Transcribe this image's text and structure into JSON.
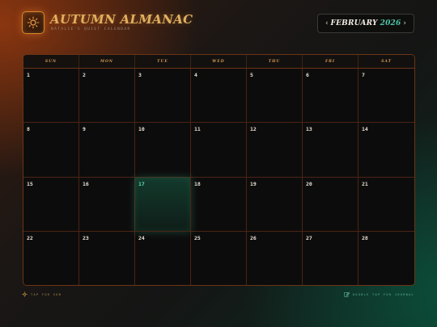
{
  "header": {
    "title": "AUTUMN ALMANAC",
    "subtitle": "NATALIE'S QUIET CALENDAR",
    "logo_icon": "sun-icon"
  },
  "month_nav": {
    "prev_icon": "chevron-left-icon",
    "prev_label": "‹",
    "month": "FEBRUARY",
    "year": "2026",
    "next_icon": "chevron-right-icon",
    "next_label": "›"
  },
  "calendar": {
    "weekdays": [
      "SUN",
      "MON",
      "TUE",
      "WED",
      "THU",
      "FRI",
      "SAT"
    ],
    "days": [
      "1",
      "2",
      "3",
      "4",
      "5",
      "6",
      "7",
      "8",
      "9",
      "10",
      "11",
      "12",
      "13",
      "14",
      "15",
      "16",
      "17",
      "18",
      "19",
      "20",
      "21",
      "22",
      "23",
      "24",
      "25",
      "26",
      "27",
      "28"
    ],
    "today": "17"
  },
  "footer": {
    "left_icon": "sun-icon",
    "left_hint": "TAP FOR SUN",
    "right_icon": "edit-icon",
    "right_hint": "DOUBLE TAP FOR JOURNAL"
  },
  "colors": {
    "accent_amber": "#e2b05d",
    "accent_teal": "#4ec7a6",
    "grid_line": "#6b3416",
    "background": "#141514"
  }
}
